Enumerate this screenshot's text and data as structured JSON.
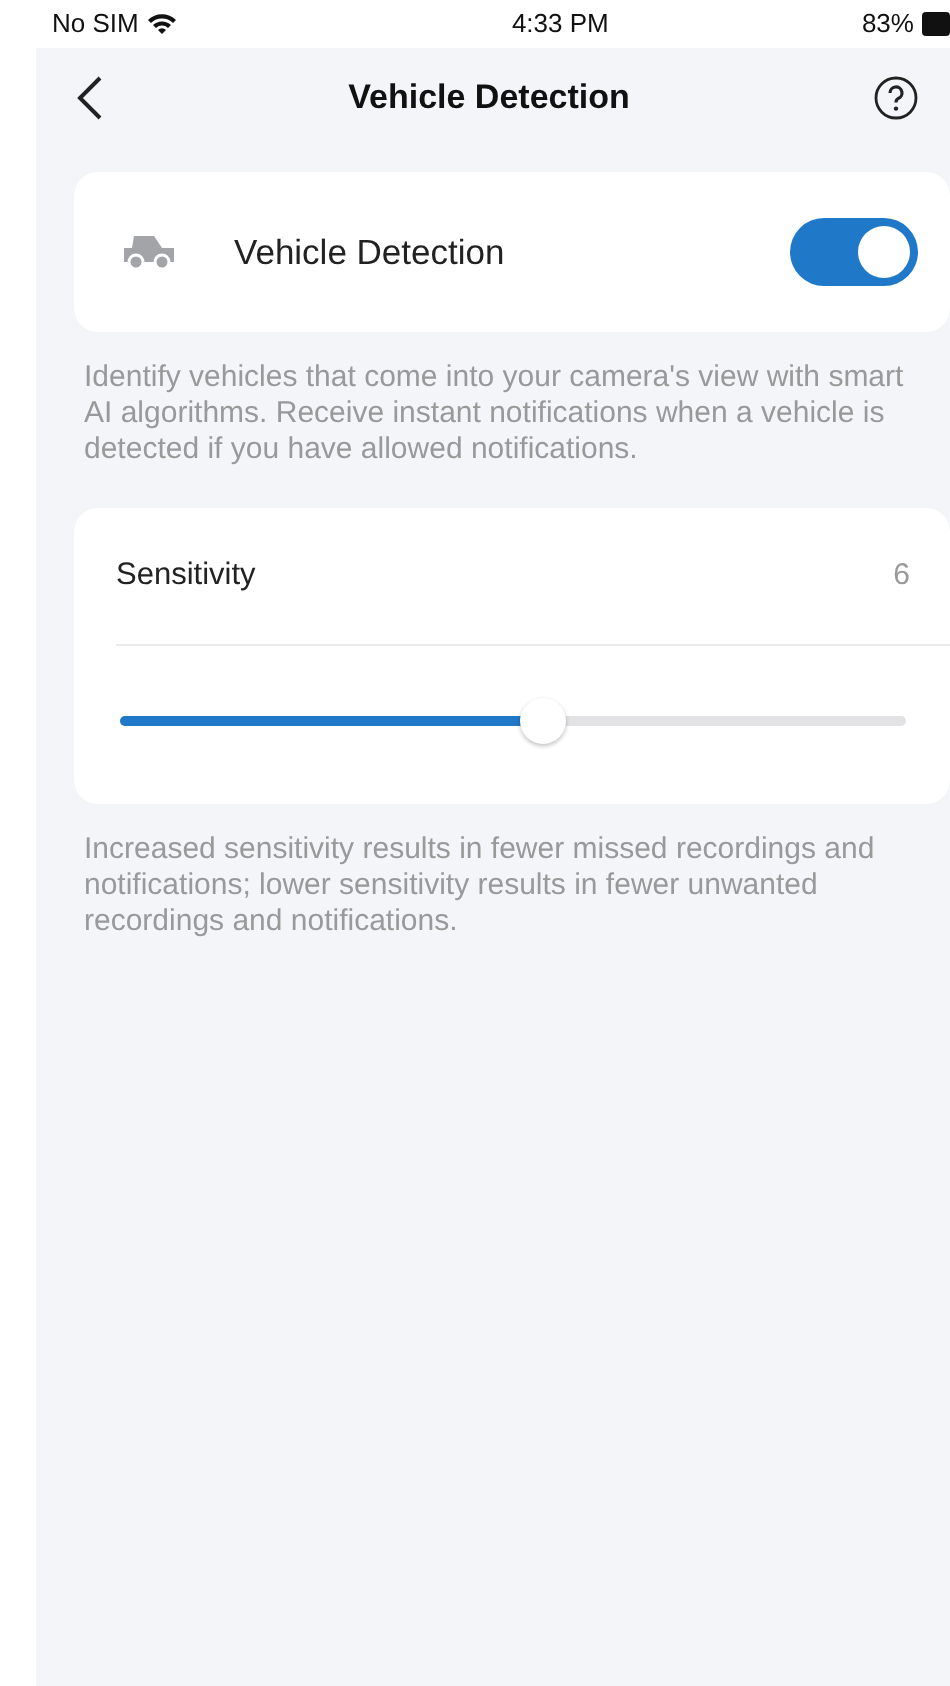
{
  "status_bar": {
    "carrier": "No SIM",
    "time": "4:33 PM",
    "battery": "83%"
  },
  "nav": {
    "title": "Vehicle Detection"
  },
  "detection": {
    "label": "Vehicle Detection",
    "on": true,
    "description": "Identify vehicles that come into your camera's view with smart AI algorithms. Receive instant notifications when a vehicle is detected if you have allowed notifications."
  },
  "sensitivity": {
    "label": "Sensitivity",
    "value": "6",
    "level": 0.54,
    "description": "Increased sensitivity results in fewer missed recordings and notifications; lower sensitivity results in fewer unwanted recordings and notifications."
  }
}
